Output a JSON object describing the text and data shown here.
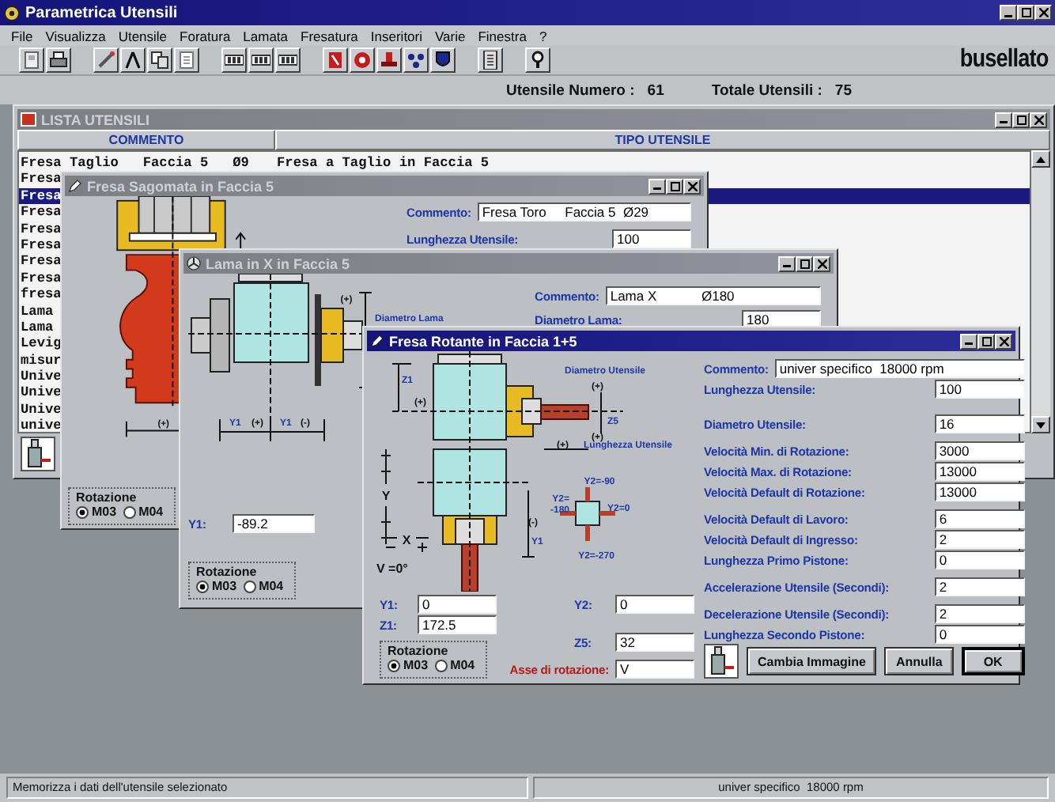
{
  "app": {
    "title": "Parametrica Utensili",
    "menu": [
      "File",
      "Visualizza",
      "Utensile",
      "Foratura",
      "Lamata",
      "Fresatura",
      "Inseritori",
      "Varie",
      "Finestra",
      "?"
    ],
    "logo": "busellato",
    "info": [
      {
        "label": "Utensile Numero :",
        "value": "61"
      },
      {
        "label": "Totale Utensili :",
        "value": "75"
      }
    ]
  },
  "tool_list": {
    "title": "LISTA UTENSILI",
    "active": false,
    "columns": [
      "COMMENTO",
      "TIPO UTENSILE"
    ],
    "rows": [
      {
        "comment": "Fresa Taglio   Faccia 5   Ø9",
        "type": "Fresa a Taglio in Faccia 5",
        "selected": false
      },
      {
        "comment": "Fresa",
        "selected": false
      },
      {
        "comment": "Fresa",
        "selected": true
      },
      {
        "comment": "Fresa",
        "selected": false
      },
      {
        "comment": "Fresa",
        "selected": false
      },
      {
        "comment": "Fresa",
        "selected": false
      },
      {
        "comment": "Fresa",
        "selected": false
      },
      {
        "comment": "Fresa",
        "selected": false
      },
      {
        "comment": "fresa",
        "selected": false
      },
      {
        "comment": "Lama",
        "selected": false
      },
      {
        "comment": "Lama",
        "selected": false
      },
      {
        "comment": "Levig",
        "selected": false
      },
      {
        "comment": "misur",
        "selected": false
      },
      {
        "comment": "Unive",
        "selected": false
      },
      {
        "comment": "Unive",
        "selected": false
      },
      {
        "comment": "Unive",
        "selected": false
      },
      {
        "comment": "unive",
        "selected": false
      }
    ]
  },
  "windows": [
    {
      "kind": "profile",
      "title": "Fresa Sagomata in Faccia 5",
      "active": false,
      "fields": [
        {
          "label": "Commento:",
          "value": "Fresa Toro     Faccia 5  Ø29",
          "kind": "comment"
        },
        {
          "label": "Lunghezza Utensile:",
          "value": "100",
          "kind": "number"
        }
      ],
      "drawing_labels": [
        "(+)"
      ],
      "rotation": {
        "label": "Rotazione",
        "options": [
          {
            "label": "M03",
            "selected": true
          },
          {
            "label": "M04",
            "selected": false
          }
        ]
      }
    },
    {
      "kind": "blade",
      "title": "Lama in X in Faccia 5",
      "active": false,
      "fields": [
        {
          "label": "Commento:",
          "value": "Lama X            Ø180",
          "kind": "comment"
        },
        {
          "label": "Diametro Lama:",
          "value": "180",
          "kind": "number"
        }
      ],
      "drawing_labels": [
        "(+)",
        "Diametro Lama",
        "Y1",
        "(+)",
        "Y1",
        "(-)"
      ],
      "position_fields": [
        {
          "label": "Y1:",
          "value": "-89.2",
          "kind": "coord"
        }
      ],
      "rotation": {
        "label": "Rotazione",
        "options": [
          {
            "label": "M03",
            "selected": true
          },
          {
            "label": "M04",
            "selected": false
          }
        ]
      }
    },
    {
      "kind": "rotating",
      "title": "Fresa Rotante in Faccia 1+5",
      "active": true,
      "field_groups": [
        [
          {
            "label": "Commento:",
            "value": "univer specifico  18000 rpm",
            "kind": "comment"
          },
          {
            "label": "Lunghezza Utensile:",
            "value": "100",
            "kind": "number"
          }
        ],
        [
          {
            "label": "Diametro Utensile:",
            "value": "16",
            "kind": "number"
          }
        ],
        [
          {
            "label": "Velocità Min. di Rotazione:",
            "value": "3000",
            "kind": "number"
          },
          {
            "label": "Velocità Max. di Rotazione:",
            "value": "13000",
            "kind": "number"
          },
          {
            "label": "Velocità Default di Rotazione:",
            "value": "13000",
            "kind": "number"
          }
        ],
        [
          {
            "label": "Velocità Default di Lavoro:",
            "value": "6",
            "kind": "number"
          },
          {
            "label": "Velocità Default di Ingresso:",
            "value": "2",
            "kind": "number"
          },
          {
            "label": "Lunghezza Primo Pistone:",
            "value": "0",
            "kind": "number"
          }
        ],
        [
          {
            "label": "Accelerazione Utensile (Secondi):",
            "value": "2",
            "kind": "number"
          }
        ],
        [
          {
            "label": "Decelerazione Utensile (Secondi):",
            "value": "2",
            "kind": "number"
          },
          {
            "label": "Lunghezza Secondo Pistone:",
            "value": "0",
            "kind": "number"
          }
        ]
      ],
      "drawing_labels": [
        "Diametro Utensile",
        "Lunghezza Utensile",
        "Z1",
        "(+)",
        "(+)",
        "Z5",
        "(+)",
        "(+)",
        "Y2=-90",
        "Y2=",
        "-180",
        "Y2=0",
        "Y2=-270",
        "(-)",
        "Y1",
        "Y",
        "X",
        "V =0°"
      ],
      "position_fields": [
        {
          "label": "Y1:",
          "value": "0",
          "kind": "coord"
        },
        {
          "label": "Z1:",
          "value": "172.5",
          "kind": "coord"
        },
        {
          "label": "Y2:",
          "value": "0",
          "kind": "coord"
        },
        {
          "label": "Z5:",
          "value": "32",
          "kind": "coord"
        },
        {
          "label": "Asse di rotazione:",
          "value": "V",
          "kind": "axis"
        }
      ],
      "rotation": {
        "label": "Rotazione",
        "options": [
          {
            "label": "M03",
            "selected": true
          },
          {
            "label": "M04",
            "selected": false
          }
        ]
      },
      "buttons": [
        {
          "label": "Cambia Immagine",
          "default": false
        },
        {
          "label": "Annulla",
          "default": false
        },
        {
          "label": "OK",
          "default": true
        }
      ]
    }
  ],
  "status_bar": [
    "Memorizza i dati dell'utensile selezionato",
    "univer specifico  18000 rpm"
  ]
}
